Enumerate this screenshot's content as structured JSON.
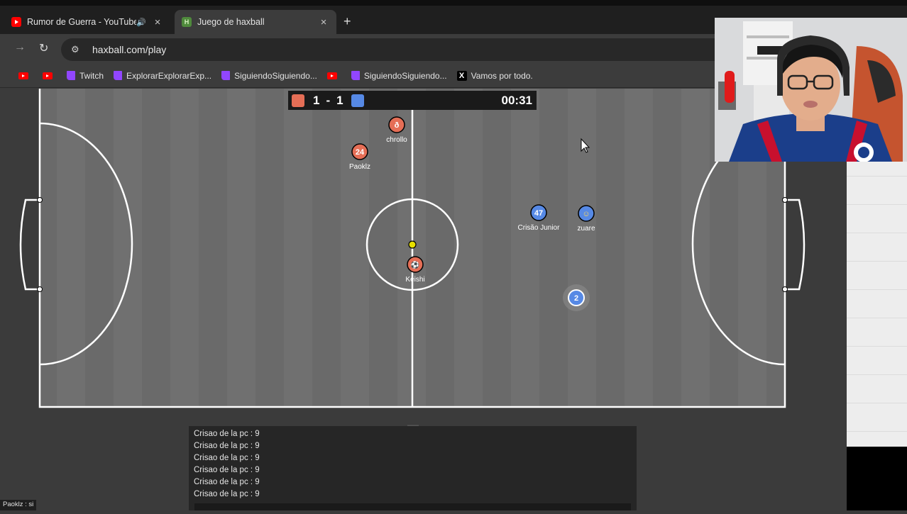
{
  "browser": {
    "tabs": [
      {
        "title": "Rumor de Guerra - YouTube",
        "favicon": "youtube-icon",
        "active": false,
        "audio": true
      },
      {
        "title": "Juego de haxball",
        "favicon": "haxball-icon",
        "active": true,
        "audio": false
      }
    ],
    "url": "haxball.com/play",
    "bookmarks": [
      {
        "label": "",
        "icon": "youtube-icon"
      },
      {
        "label": "",
        "icon": "youtube-icon"
      },
      {
        "label": "Twitch",
        "icon": "twitch-icon"
      },
      {
        "label": "ExplorarExplorarExp...",
        "icon": "twitch-icon"
      },
      {
        "label": "SiguiendoSiguiendo...",
        "icon": "twitch-icon"
      },
      {
        "label": "",
        "icon": "youtube-icon"
      },
      {
        "label": "SiguiendoSiguiendo...",
        "icon": "twitch-icon"
      },
      {
        "label": "Vamos por todo.",
        "icon": "x-icon"
      }
    ]
  },
  "scoreboard": {
    "red_score": "1",
    "separator": "-",
    "blue_score": "1",
    "time": "00:31",
    "red_color": "#e56e56",
    "blue_color": "#5689e5"
  },
  "players": [
    {
      "number": "ð",
      "name": "chrollo",
      "team": "red"
    },
    {
      "number": "24",
      "name": "Paoklz",
      "team": "red"
    },
    {
      "number": "⚽",
      "name": "Keishi",
      "team": "red"
    },
    {
      "number": "47",
      "name": "Crisão Junior",
      "team": "blue"
    },
    {
      "number": "☺",
      "name": "zuare",
      "team": "blue"
    },
    {
      "number": "2",
      "name": "",
      "team": "blue"
    }
  ],
  "chat": {
    "messages": [
      "Crisao de la pc : 9",
      "Crisao de la pc : 9",
      "Crisao de la pc : 9",
      "Crisao de la pc : 9",
      "Crisao de la pc : 9",
      "Crisao de la pc : 9"
    ]
  },
  "status_bar": "Paoklz : si",
  "colors": {
    "field": "#6f6f6f",
    "red_team": "#e56e56",
    "blue_team": "#5689e5",
    "ball": "#e8e000"
  }
}
